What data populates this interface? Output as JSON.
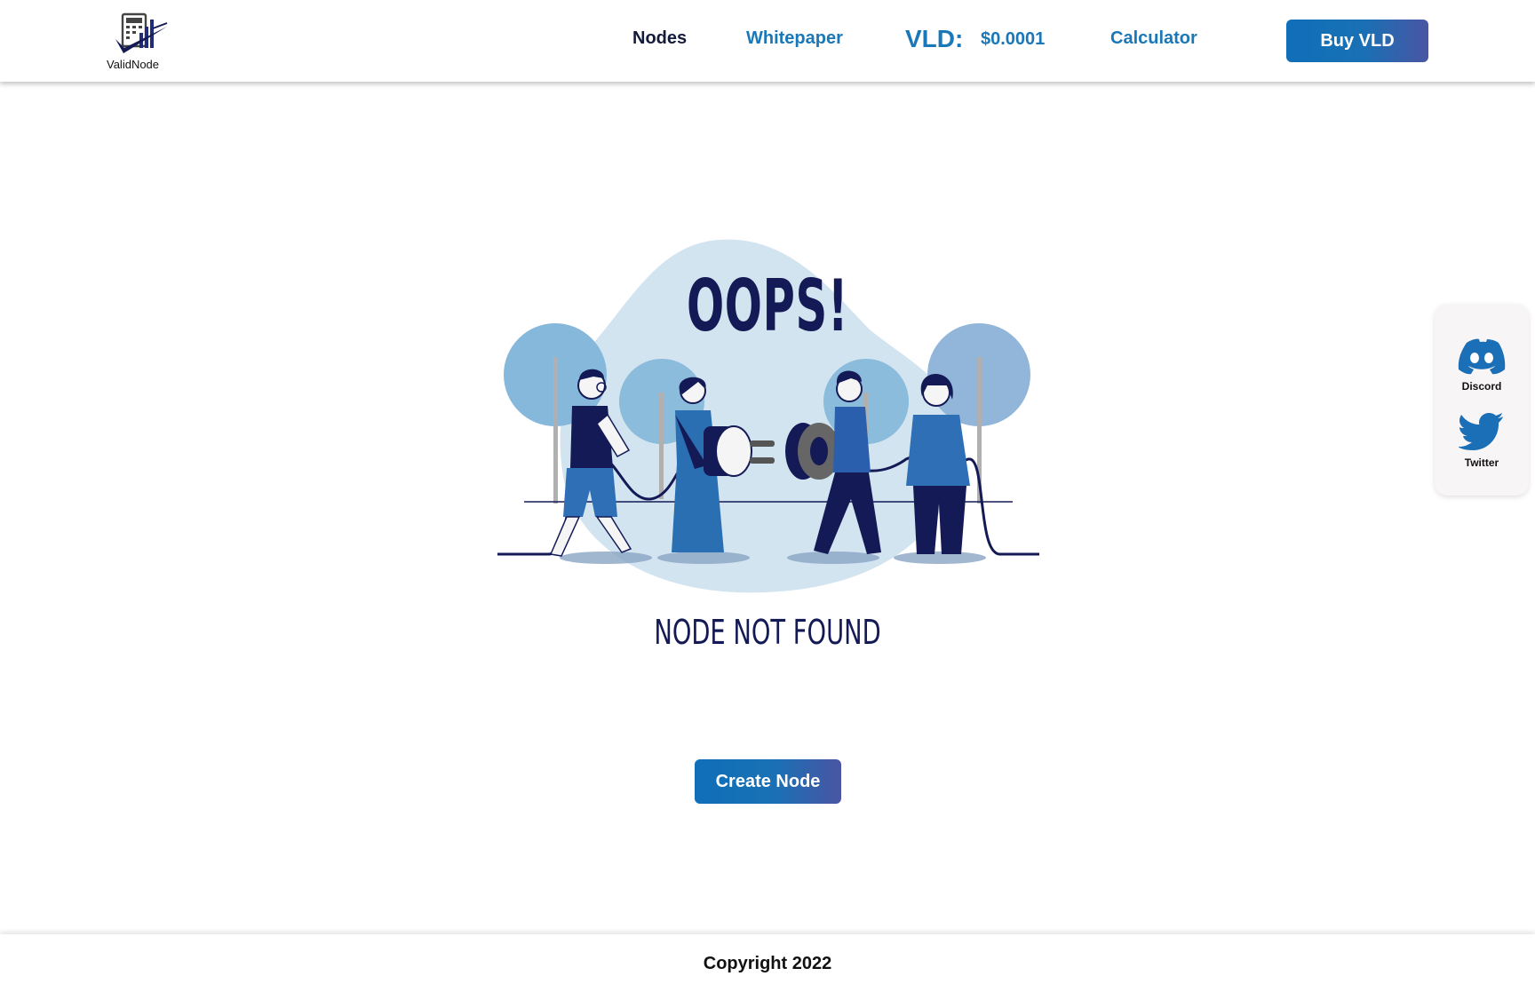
{
  "brand": {
    "name": "ValidNode",
    "logo_icon": "calculator-chart-check-logo"
  },
  "nav": {
    "items": [
      {
        "label": "Nodes"
      },
      {
        "label": "Whitepaper"
      },
      {
        "label": "Calculator"
      }
    ],
    "token_label": "VLD:",
    "token_price": "$0.0001",
    "buy_label": "Buy VLD"
  },
  "main": {
    "title": "OOPS!",
    "message": "NODE NOT FOUND",
    "create_label": "Create Node",
    "illustration": "people-connecting-plug-illustration"
  },
  "social": {
    "items": [
      {
        "label": "Discord",
        "icon": "discord-icon"
      },
      {
        "label": "Twitter",
        "icon": "twitter-icon"
      }
    ]
  },
  "footer": {
    "copyright": "Copyright 2022"
  },
  "colors": {
    "primary": "#1a78b8",
    "dark_navy": "#141a55",
    "button_gradient_end": "#4a55a3",
    "blob": "#d3e4f1"
  }
}
